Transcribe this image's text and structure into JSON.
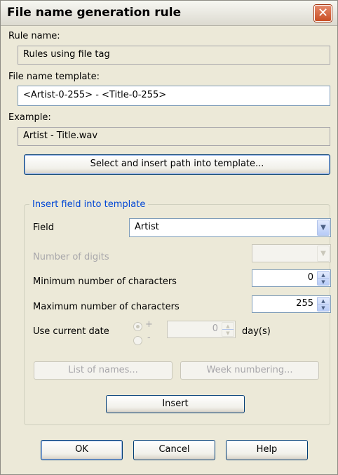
{
  "window": {
    "title": "File name generation rule",
    "close_icon": "close-icon"
  },
  "rule_name": {
    "label": "Rule name:",
    "value": "Rules using file tag"
  },
  "template": {
    "label": "File name template:",
    "value": "<Artist-0-255> - <Title-0-255>"
  },
  "example": {
    "label": "Example:",
    "value": "Artist - Title.wav"
  },
  "select_path_button": "Select and insert path into template...",
  "insert_field": {
    "group_caption": "Insert field into template",
    "field_label": "Field",
    "field_value": "Artist",
    "digits_label": "Number of digits",
    "digits_value": "",
    "min_chars_label": "Minimum number of characters",
    "min_chars_value": "0",
    "max_chars_label": "Maximum number of characters",
    "max_chars_value": "255",
    "use_date_label": "Use current date",
    "plus_label": "+",
    "minus_label": "-",
    "days_value": "0",
    "days_label": "day(s)",
    "list_names_button": "List of names...",
    "week_numbering_button": "Week numbering...",
    "insert_button": "Insert"
  },
  "buttons": {
    "ok": "OK",
    "cancel": "Cancel",
    "help": "Help"
  }
}
